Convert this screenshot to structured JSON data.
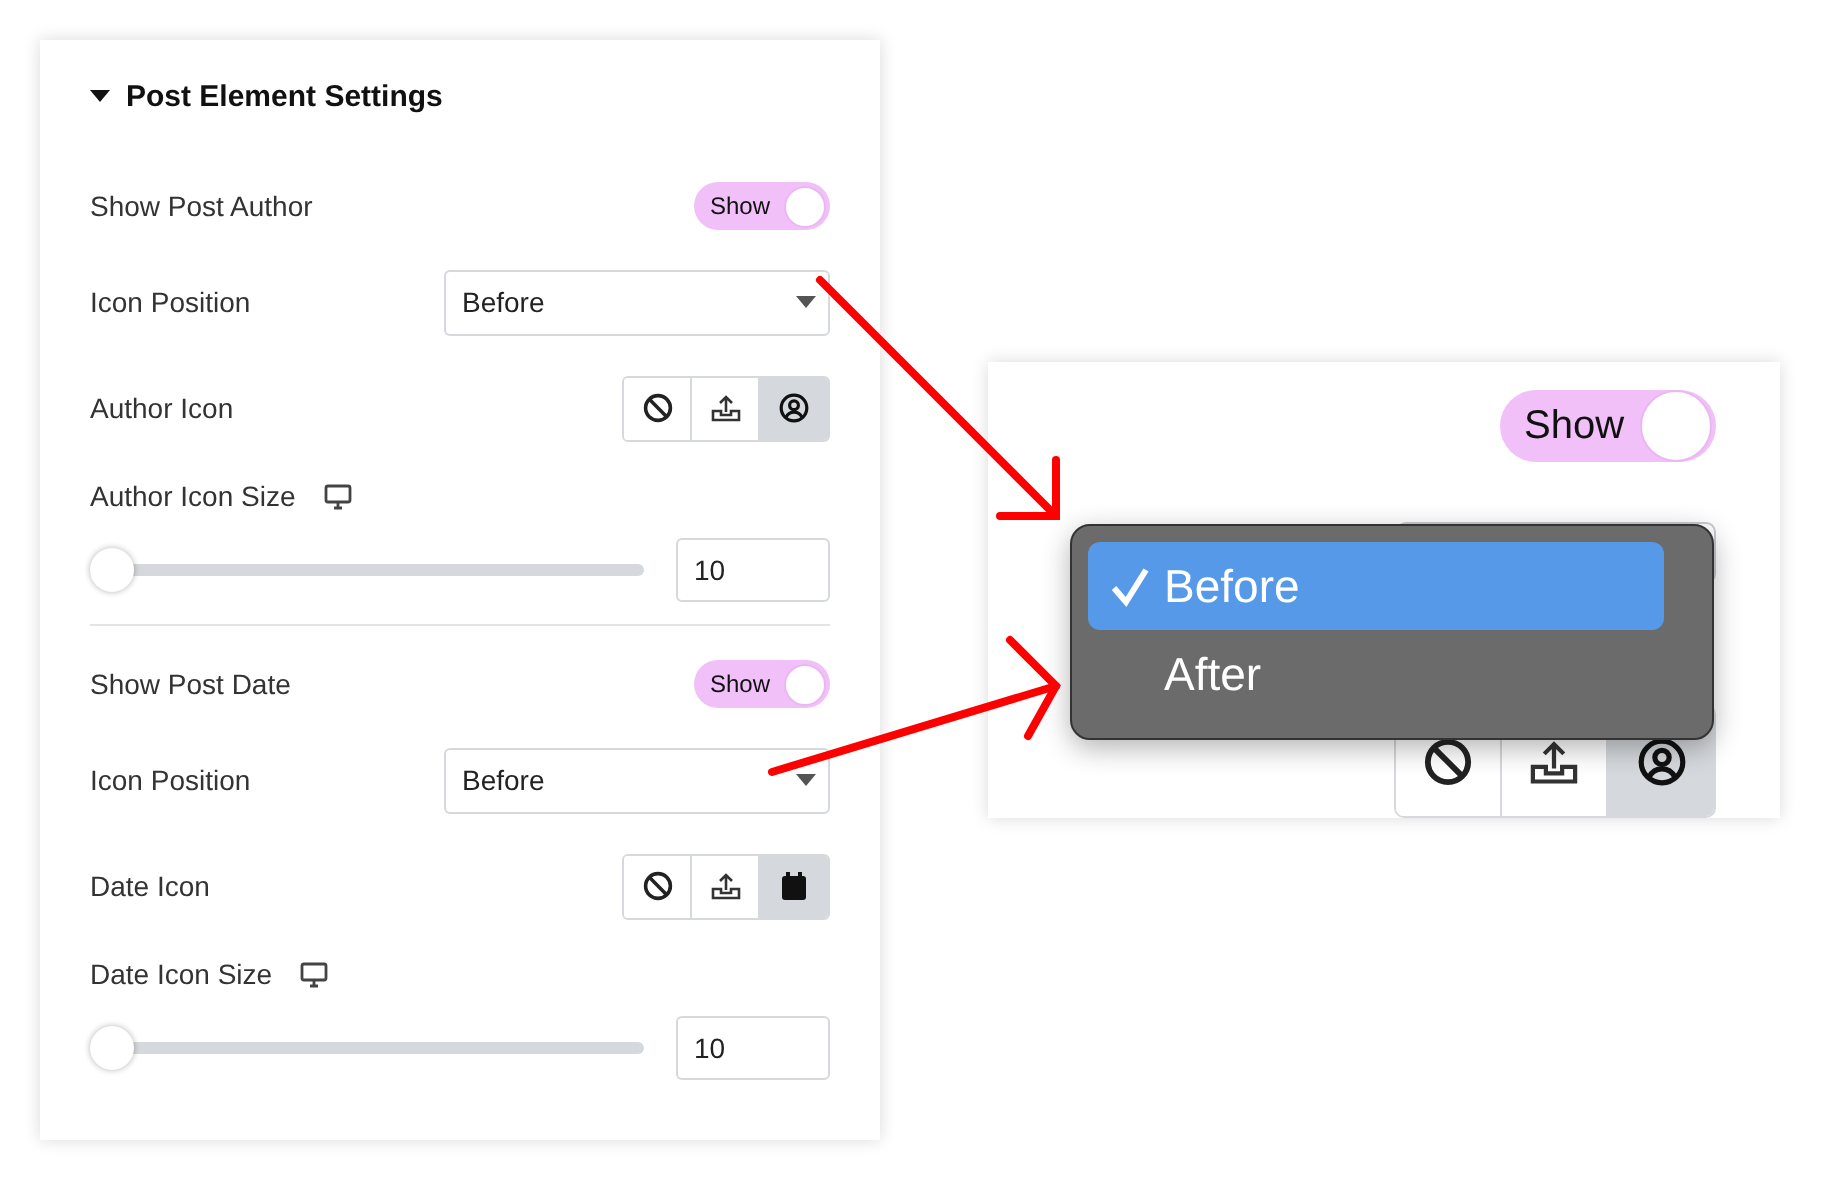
{
  "section": {
    "title": "Post Element Settings",
    "expanded": true
  },
  "groups": [
    {
      "toggle": {
        "label": "Show Post Author",
        "text": "Show",
        "on": true
      },
      "select": {
        "label": "Icon Position",
        "value": "Before"
      },
      "icon_choice": {
        "label": "Author Icon",
        "options": [
          {
            "kind": "none",
            "selected": false
          },
          {
            "kind": "upload",
            "selected": false
          },
          {
            "kind": "user",
            "selected": true
          }
        ]
      },
      "size": {
        "label": "Author Icon Size",
        "level": 0,
        "value": "10"
      }
    },
    {
      "toggle": {
        "label": "Show Post Date",
        "text": "Show",
        "on": true
      },
      "select": {
        "label": "Icon Position",
        "value": "Before"
      },
      "icon_choice": {
        "label": "Date Icon",
        "options": [
          {
            "kind": "none",
            "selected": false
          },
          {
            "kind": "upload",
            "selected": false
          },
          {
            "kind": "calendar",
            "selected": true
          }
        ]
      },
      "size": {
        "label": "Date Icon Size",
        "level": 0,
        "value": "10"
      }
    }
  ],
  "zoom_view": {
    "toggle": {
      "text": "Show",
      "on": true
    },
    "menu": {
      "options": [
        {
          "label": "Before",
          "selected": true
        },
        {
          "label": "After",
          "selected": false
        }
      ]
    },
    "icon_choice": {
      "options": [
        {
          "kind": "none",
          "selected": false
        },
        {
          "kind": "upload",
          "selected": false
        },
        {
          "kind": "user",
          "selected": true
        }
      ]
    }
  }
}
